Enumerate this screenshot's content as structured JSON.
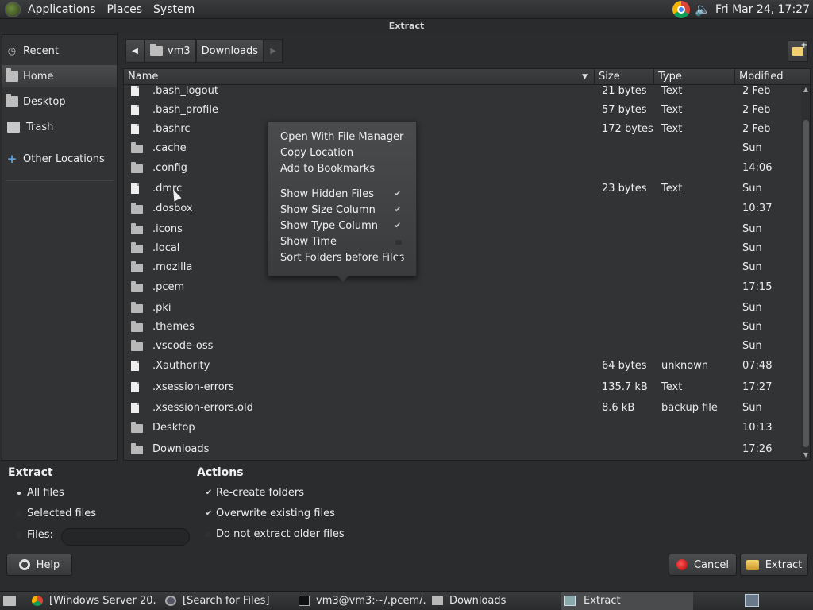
{
  "top_panel": {
    "menus": [
      "Applications",
      "Places",
      "System"
    ],
    "clock": "Fri Mar 24, 17:27"
  },
  "window": {
    "title": "Extract"
  },
  "sidebar": {
    "items": [
      {
        "label": "Recent",
        "icon": "clock-icon"
      },
      {
        "label": "Home",
        "icon": "home-folder-icon"
      },
      {
        "label": "Desktop",
        "icon": "desktop-folder-icon"
      },
      {
        "label": "Trash",
        "icon": "trash-icon"
      },
      {
        "label": "Other Locations",
        "icon": "plus-icon"
      }
    ]
  },
  "pathbar": {
    "segments": [
      "vm3",
      "Downloads"
    ]
  },
  "list": {
    "columns": [
      "Name",
      "Size",
      "Type",
      "Modified"
    ],
    "rows": [
      {
        "name": ".bash_logout",
        "size": "21 bytes",
        "type": "Text",
        "modified": "2 Feb",
        "kind": "file"
      },
      {
        "name": ".bash_profile",
        "size": "57 bytes",
        "type": "Text",
        "modified": "2 Feb",
        "kind": "file"
      },
      {
        "name": ".bashrc",
        "size": "172 bytes",
        "type": "Text",
        "modified": "2 Feb",
        "kind": "file"
      },
      {
        "name": ".cache",
        "size": "",
        "type": "",
        "modified": "Sun",
        "kind": "dir"
      },
      {
        "name": ".config",
        "size": "",
        "type": "",
        "modified": "14:06",
        "kind": "dir"
      },
      {
        "name": ".dmrc",
        "size": "23 bytes",
        "type": "Text",
        "modified": "Sun",
        "kind": "file"
      },
      {
        "name": ".dosbox",
        "size": "",
        "type": "",
        "modified": "10:37",
        "kind": "dir"
      },
      {
        "name": ".icons",
        "size": "",
        "type": "",
        "modified": "Sun",
        "kind": "dir"
      },
      {
        "name": ".local",
        "size": "",
        "type": "",
        "modified": "Sun",
        "kind": "dir"
      },
      {
        "name": ".mozilla",
        "size": "",
        "type": "",
        "modified": "Sun",
        "kind": "dir"
      },
      {
        "name": ".pcem",
        "size": "",
        "type": "",
        "modified": "17:15",
        "kind": "dir"
      },
      {
        "name": ".pki",
        "size": "",
        "type": "",
        "modified": "Sun",
        "kind": "dir"
      },
      {
        "name": ".themes",
        "size": "",
        "type": "",
        "modified": "Sun",
        "kind": "dir"
      },
      {
        "name": ".vscode-oss",
        "size": "",
        "type": "",
        "modified": "Sun",
        "kind": "dir"
      },
      {
        "name": ".Xauthority",
        "size": "64 bytes",
        "type": "unknown",
        "modified": "07:48",
        "kind": "file"
      },
      {
        "name": ".xsession-errors",
        "size": "135.7 kB",
        "type": "Text",
        "modified": "17:27",
        "kind": "file"
      },
      {
        "name": ".xsession-errors.old",
        "size": "8.6 kB",
        "type": "backup file",
        "modified": "Sun",
        "kind": "file"
      },
      {
        "name": "Desktop",
        "size": "",
        "type": "",
        "modified": "10:13",
        "kind": "dir"
      },
      {
        "name": "Downloads",
        "size": "",
        "type": "",
        "modified": "17:26",
        "kind": "dir"
      }
    ]
  },
  "context_menu": {
    "items": [
      {
        "label": "Open With File Manager"
      },
      {
        "label": "Copy Location"
      },
      {
        "label": "Add to Bookmarks"
      },
      {
        "label": "Show Hidden Files",
        "checked": true
      },
      {
        "label": "Show Size Column",
        "checked": true
      },
      {
        "label": "Show Type Column",
        "checked": true
      },
      {
        "label": "Show Time",
        "checked": false
      },
      {
        "label": "Sort Folders before Files",
        "checked": false
      }
    ]
  },
  "extract": {
    "title": "Extract",
    "all_files": "All files",
    "selected_files": "Selected files",
    "files_label": "Files:",
    "files_value": ""
  },
  "actions": {
    "title": "Actions",
    "recreate": "Re-create folders",
    "overwrite": "Overwrite existing files",
    "no_older": "Do not extract older files"
  },
  "buttons": {
    "help": "Help",
    "cancel": "Cancel",
    "extract": "Extract"
  },
  "taskbar": {
    "tasks": [
      "[Windows Server 20...",
      "[Search for Files]",
      "vm3@vm3:~/.pcem/...",
      "Downloads",
      "Extract"
    ]
  }
}
